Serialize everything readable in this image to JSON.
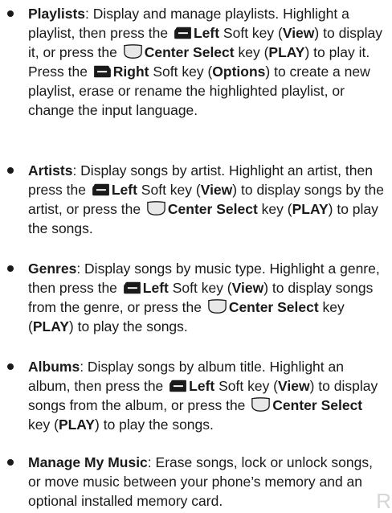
{
  "items": [
    {
      "term": "Playlists",
      "sep": ": ",
      "t1": "Display and manage playlists. Highlight a playlist, then press the ",
      "k1": "Left",
      "t2": " Soft key (",
      "k2": "View",
      "t3": ") to display it, or press the ",
      "k3": "Center Select",
      "t4": " key (",
      "k4": "PLAY",
      "t5": ") to play it. Press the ",
      "k5": "Right",
      "t6": " Soft key (",
      "k6": "Options",
      "t7": ") to create a new playlist, erase or rename the highlighted playlist, or change the input language."
    },
    {
      "term": "Artists",
      "sep": ": ",
      "t1": "Display songs by artist. Highlight an artist, then press the ",
      "k1": "Left",
      "t2": " Soft key (",
      "k2": "View",
      "t3": ") to display songs by the artist, or press the ",
      "k3": "Center Select",
      "t4": " key (",
      "k4": "PLAY",
      "t5": ") to play the songs."
    },
    {
      "term": "Genres",
      "sep": ": ",
      "t1": "Display songs by music type. Highlight a genre, then press the ",
      "k1": "Left",
      "t2": " Soft key (",
      "k2": "View",
      "t3": ") to display songs from the genre, or press the ",
      "k3": "Center Select",
      "t4": " key (",
      "k4": "PLAY",
      "t5": ") to play the songs."
    },
    {
      "term": "Albums",
      "sep": ": ",
      "t1": "Display songs by album title. Highlight an album, then press the ",
      "k1": "Left",
      "t2": " Soft key (",
      "k2": "View",
      "t3": ") to display songs from the album, or press the ",
      "k3": "Center Select",
      "t4": " key (",
      "k4": "PLAY",
      "t5": ") to play the songs."
    },
    {
      "term": "Manage My Music",
      "sep": ": ",
      "t1": "Erase songs, lock or unlock songs, or move music between your phone’s memory and an optional installed memory card."
    }
  ],
  "watermark": "R"
}
